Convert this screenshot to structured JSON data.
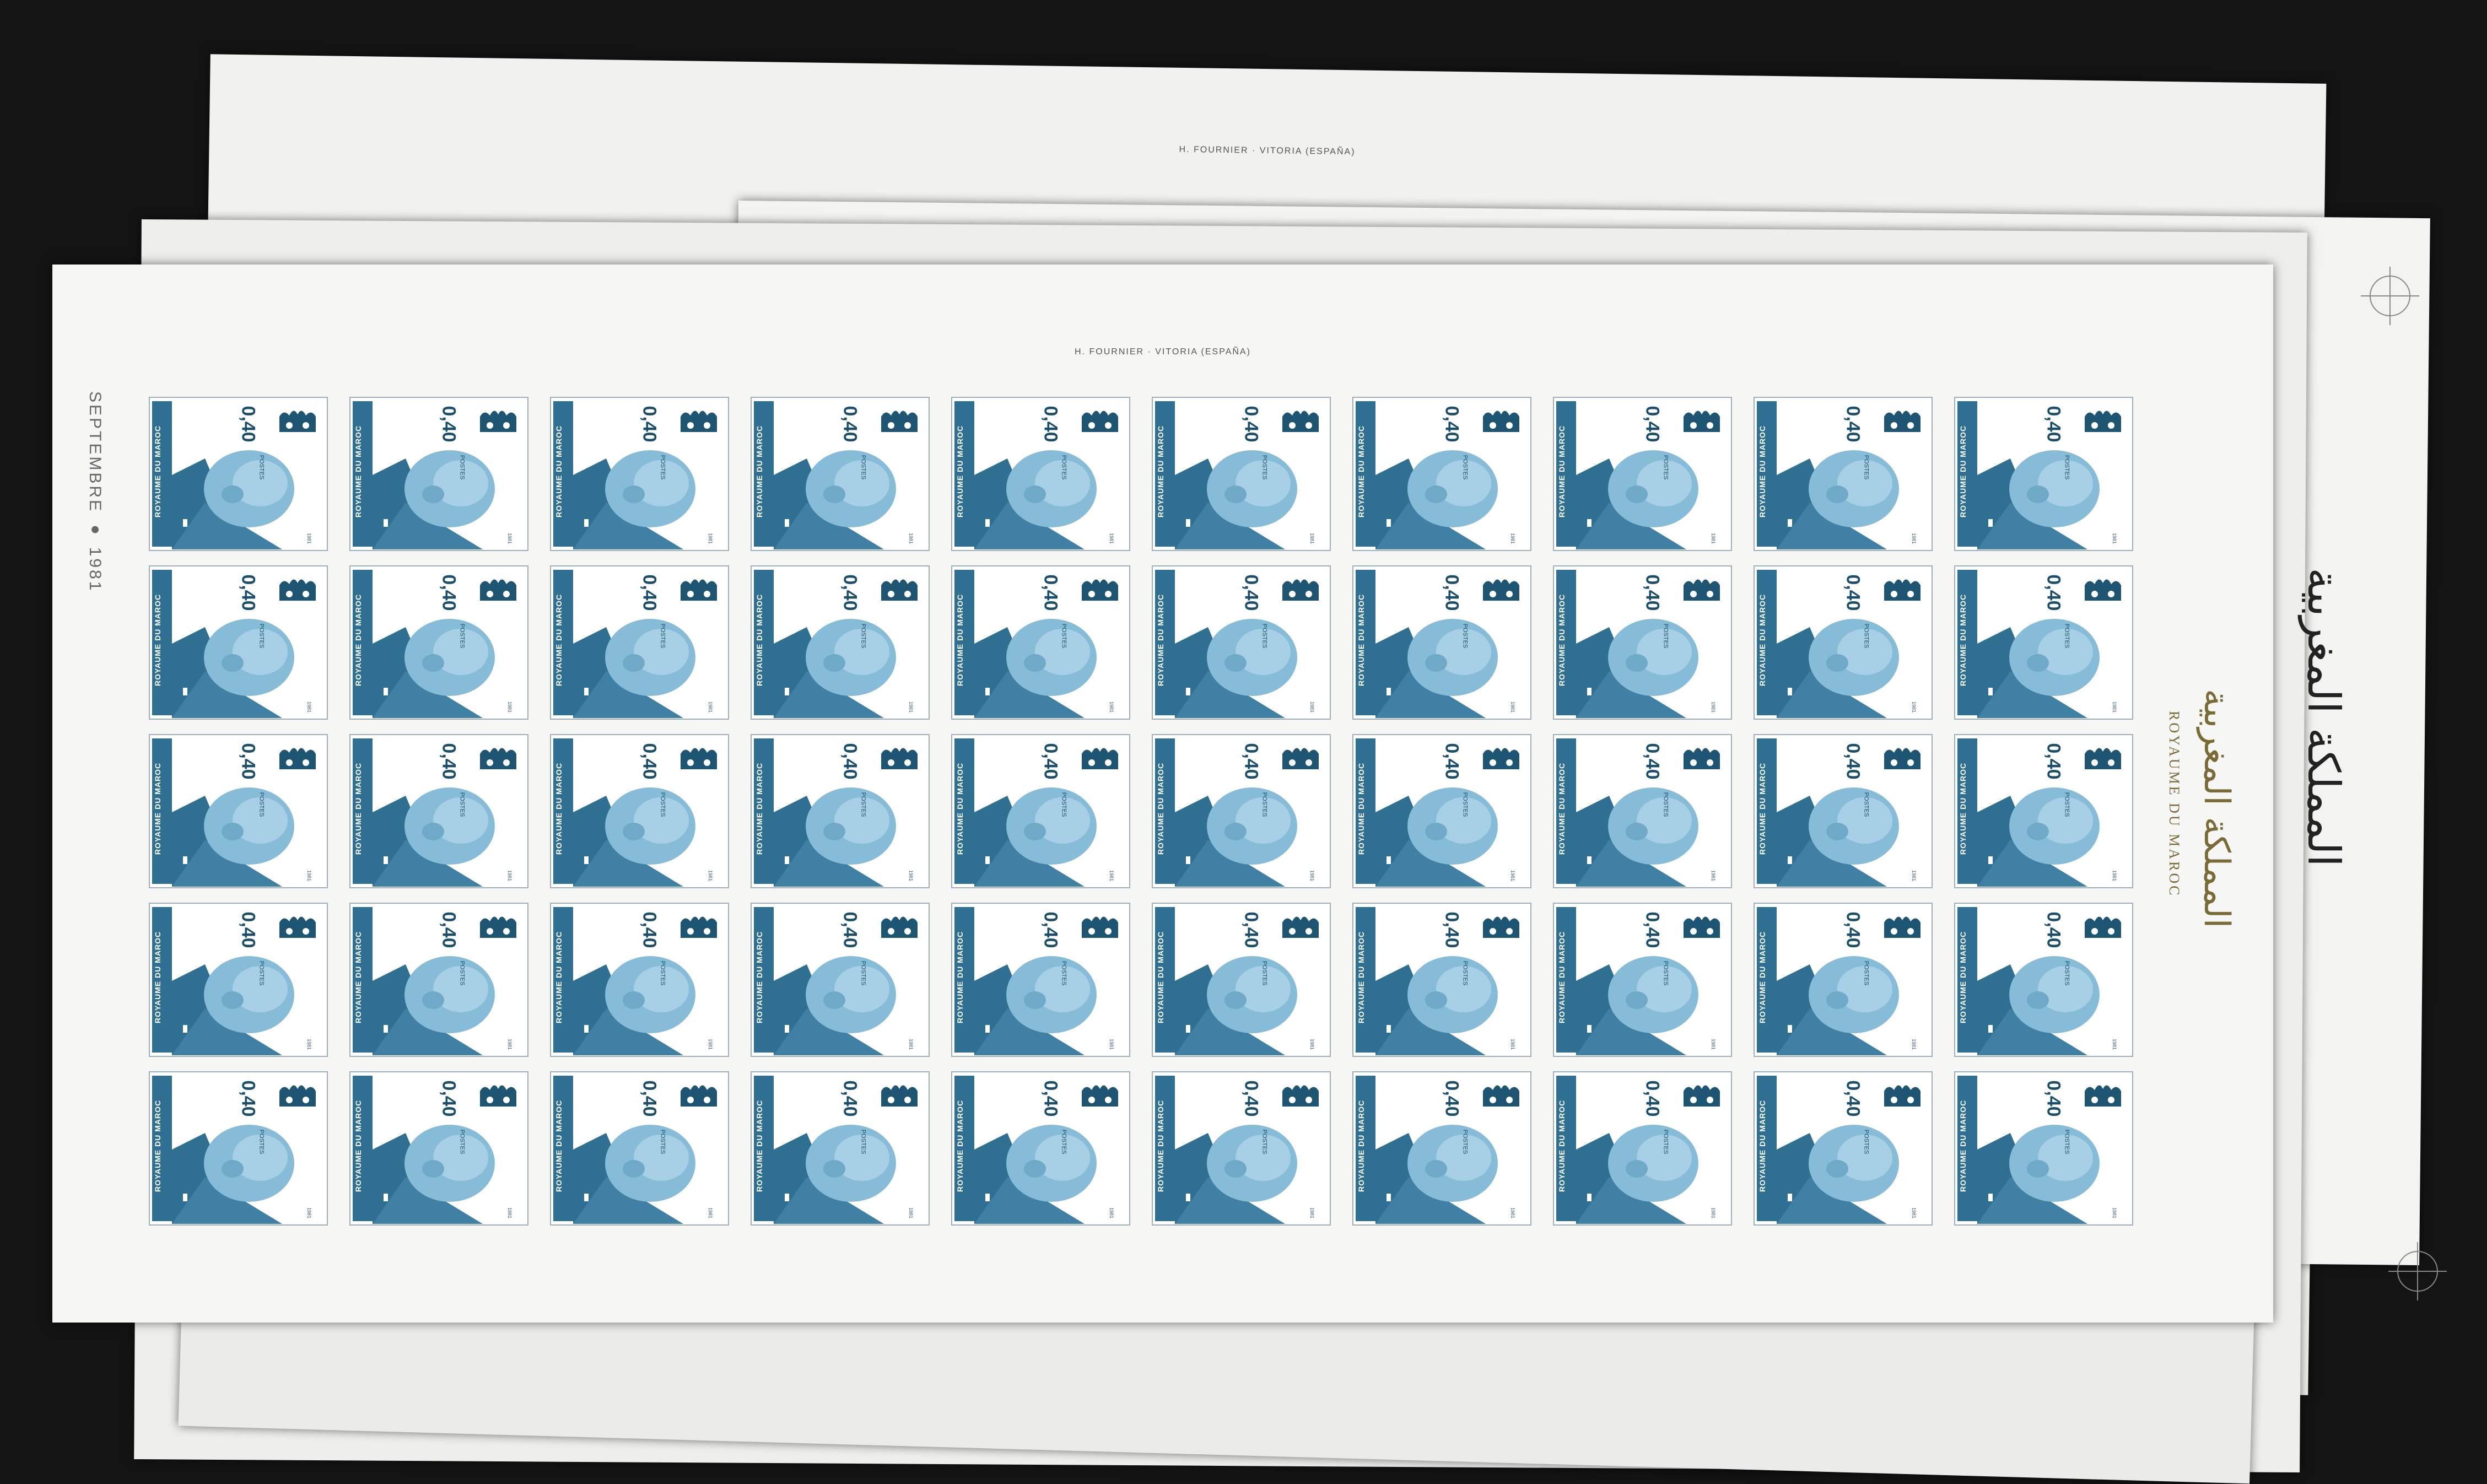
{
  "sheet": {
    "printer_imprint": "H. FOURNIER · VITORIA (ESPAÑA)",
    "date_margin": "SEPTEMBRE ● 1981",
    "side_label_fr": "ROYAUME DU MAROC",
    "side_label_ar": "المملكة المغربية"
  },
  "stamp": {
    "value": "0,40",
    "postes": "POSTES",
    "country": "ROYAUME DU MAROC",
    "year": "1981",
    "rows": 5,
    "columns": 10,
    "colors": {
      "ink": "#2f6f92",
      "portrait": "#86bcd8",
      "margin_text": "#7a6a35"
    }
  }
}
